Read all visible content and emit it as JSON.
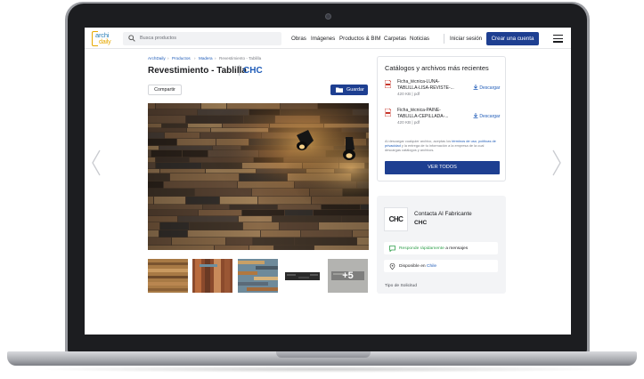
{
  "header": {
    "logo_line1": "archi",
    "logo_line2": "daily",
    "search_placeholder": "Busca productos",
    "nav": [
      "Obras",
      "Imágenes",
      "Productos & BIM",
      "Carpetas",
      "Noticias"
    ],
    "login": "Iniciar sesión",
    "signup": "Crear una cuenta"
  },
  "breadcrumb": [
    "ArchDaily",
    "Productos",
    "Madera",
    "Revestimiento - Tablilla"
  ],
  "product": {
    "title": "Revestimiento - Tablilla",
    "brand": "CHC",
    "share": "Compartir",
    "save": "Guardar",
    "more_images": "+5"
  },
  "catalogs": {
    "heading": "Catálogos y archivos más recientes",
    "files": [
      {
        "name_l1": "Ficha_técnica-LUNA-",
        "name_l2": "TABLILLA-LISA-REVISTE-...",
        "meta": "420 KB | pdf",
        "download": "Descargar"
      },
      {
        "name_l1": "Ficha_técnica-PAINE-",
        "name_l2": "TABLILLA-CEPILLADA-...",
        "meta": "420 KB | pdf",
        "download": "Descargar"
      }
    ],
    "legal_1": "Al descargar cualquier archivo, aceptas los ",
    "legal_link1": "términos de uso",
    "legal_2": ", ",
    "legal_link2": "políticas de privacidad",
    "legal_3": " y la entrega de tu información a la empresa de la cual descargas catálogos y archivos.",
    "view_all": "VER TODOS"
  },
  "contact": {
    "logo_text": "CHC",
    "line1": "Contacta Al Fabricante",
    "brand": "CHC",
    "fast_green": "Responde rápidamente",
    "fast_rest": " a mensajes",
    "available_prefix": "Disponible en ",
    "available_country": "Chile",
    "request_type": "Tipo de Solicitud"
  },
  "colors": {
    "primary": "#1e3f91",
    "link": "#1e5bb8",
    "green": "#2e9e4a"
  }
}
